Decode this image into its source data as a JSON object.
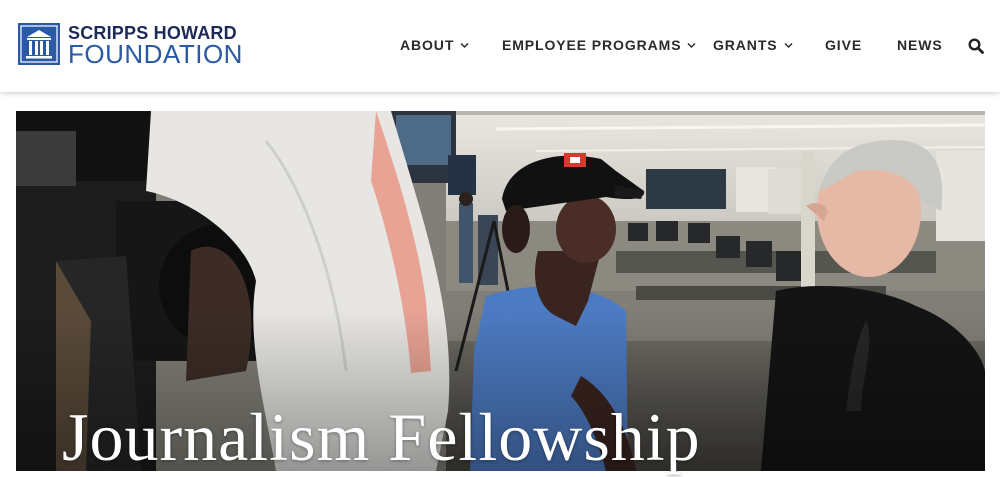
{
  "brand": {
    "name_top": "SCRIPPS HOWARD",
    "name_bottom": "FOUNDATION",
    "colors": {
      "navy": "#1d2a55",
      "blue": "#2a5aa6"
    }
  },
  "nav": {
    "items": [
      {
        "label": "ABOUT",
        "has_dropdown": true
      },
      {
        "label": "EMPLOYEE PROGRAMS",
        "has_dropdown": true
      },
      {
        "label": "GRANTS",
        "has_dropdown": true
      },
      {
        "label": "GIVE",
        "has_dropdown": false
      },
      {
        "label": "NEWS",
        "has_dropdown": false
      }
    ],
    "search_icon": "search-icon"
  },
  "hero": {
    "title": "Journalism Fellowship",
    "image": "newsroom-interview-photo"
  }
}
